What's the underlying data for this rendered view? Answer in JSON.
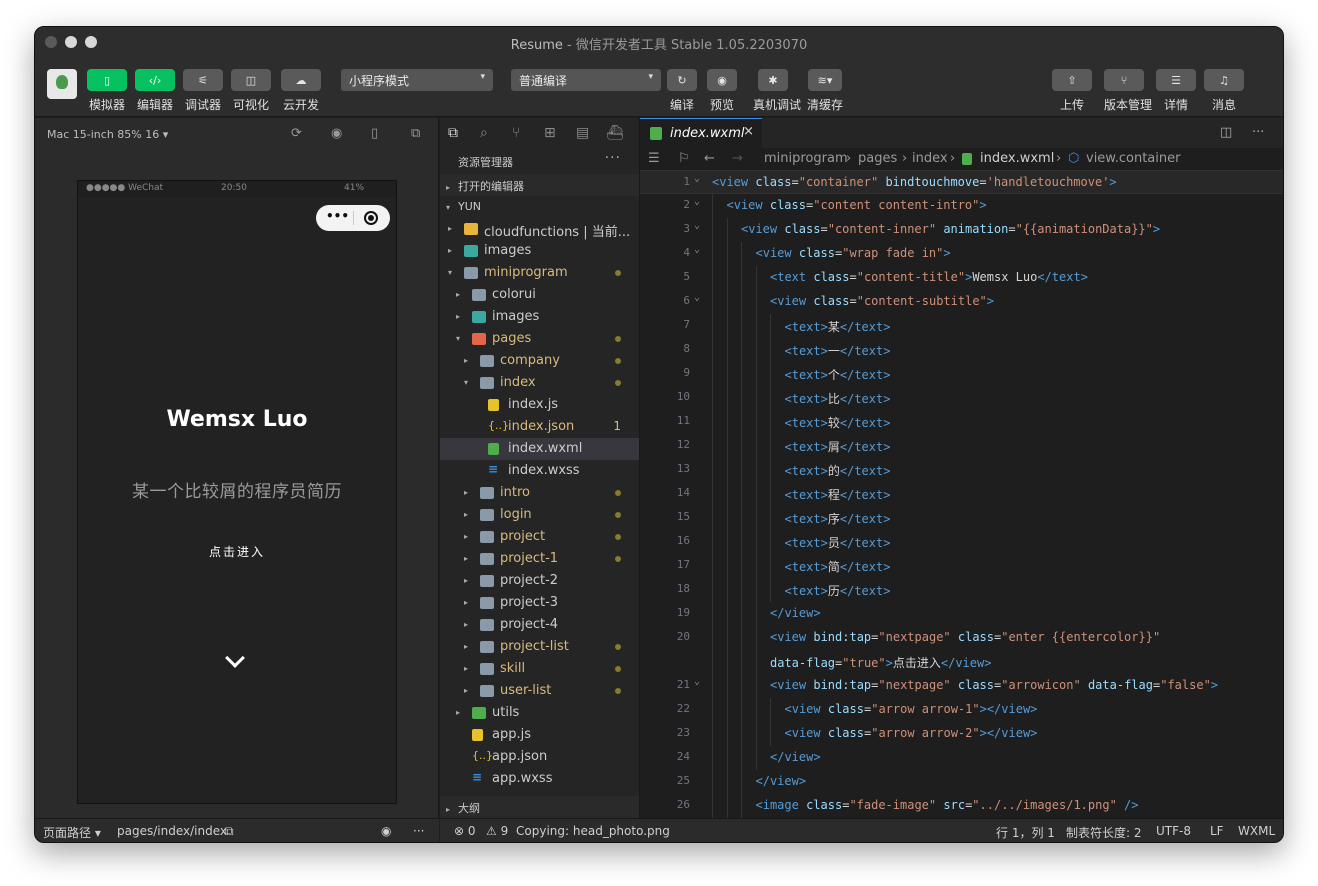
{
  "window": {
    "title_main": "Resume",
    "title_rest": " - 微信开发者工具 Stable 1.05.2203070"
  },
  "toolbar": {
    "buttons_left": [
      {
        "label": "模拟器",
        "icon": "phone-icon"
      },
      {
        "label": "编辑器",
        "icon": "code-icon"
      },
      {
        "label": "调试器",
        "icon": "debug-sliders-icon"
      },
      {
        "label": "可视化",
        "icon": "layout-icon"
      },
      {
        "label": "云开发",
        "icon": "cloud-icon"
      }
    ],
    "mode_select": "小程序模式",
    "compile_select": "普通编译",
    "buttons_mid": [
      {
        "label": "编译",
        "icon": "refresh-icon"
      },
      {
        "label": "预览",
        "icon": "eye-icon"
      },
      {
        "label": "真机调试",
        "icon": "bug-icon"
      },
      {
        "label": "清缓存",
        "icon": "layers-icon"
      }
    ],
    "buttons_right": [
      {
        "label": "上传",
        "icon": "upload-icon"
      },
      {
        "label": "版本管理",
        "icon": "branch-icon"
      },
      {
        "label": "详情",
        "icon": "menu-icon"
      },
      {
        "label": "消息",
        "icon": "bell-icon"
      }
    ]
  },
  "simulator": {
    "device": "Mac 15-inch 85% 16 ▾",
    "status_left": "●●●●● WeChat",
    "status_time": "20:50",
    "status_battery": "41%",
    "capsule_dots": "•••",
    "title": "Wemsx Luo",
    "subtitle": "某一个比较屑的程序员简历",
    "enter": "点击进入",
    "footer_path_label": "页面路径 ▾",
    "footer_path": "pages/index/index",
    "footer_more": "···"
  },
  "explorer": {
    "title": "资源管理器",
    "more": "···",
    "open_editors": "打开的编辑器",
    "project": "YUN",
    "outline": "大纲",
    "tree": [
      {
        "name": "cloudfunctions | 当前...",
        "depth": 0,
        "type": "folder-cloud",
        "caret": "▸",
        "mod": false
      },
      {
        "name": "images",
        "depth": 0,
        "type": "folder-img",
        "caret": "▸",
        "mod": false
      },
      {
        "name": "miniprogram",
        "depth": 0,
        "type": "folder-open",
        "caret": "▾",
        "mod": true,
        "dot": true
      },
      {
        "name": "colorui",
        "depth": 1,
        "type": "folder",
        "caret": "▸",
        "mod": false
      },
      {
        "name": "images",
        "depth": 1,
        "type": "folder-img",
        "caret": "▸",
        "mod": false
      },
      {
        "name": "pages",
        "depth": 1,
        "type": "folder-pg",
        "caret": "▾",
        "mod": true,
        "dot": true
      },
      {
        "name": "company",
        "depth": 2,
        "type": "folder",
        "caret": "▸",
        "mod": true,
        "dot": true
      },
      {
        "name": "index",
        "depth": 2,
        "type": "folder-open",
        "caret": "▾",
        "mod": true,
        "dot": true
      },
      {
        "name": "index.js",
        "depth": 3,
        "type": "js",
        "caret": "",
        "mod": false
      },
      {
        "name": "index.json",
        "depth": 3,
        "type": "json",
        "caret": "",
        "mod": true,
        "badge": "1"
      },
      {
        "name": "index.wxml",
        "depth": 3,
        "type": "wxml",
        "caret": "",
        "mod": false,
        "sel": true
      },
      {
        "name": "index.wxss",
        "depth": 3,
        "type": "wxss",
        "caret": "",
        "mod": false
      },
      {
        "name": "intro",
        "depth": 2,
        "type": "folder",
        "caret": "▸",
        "mod": true,
        "dot": true
      },
      {
        "name": "login",
        "depth": 2,
        "type": "folder",
        "caret": "▸",
        "mod": true,
        "dot": true
      },
      {
        "name": "project",
        "depth": 2,
        "type": "folder",
        "caret": "▸",
        "mod": true,
        "dot": true
      },
      {
        "name": "project-1",
        "depth": 2,
        "type": "folder",
        "caret": "▸",
        "mod": true,
        "dot": true
      },
      {
        "name": "project-2",
        "depth": 2,
        "type": "folder",
        "caret": "▸",
        "mod": false
      },
      {
        "name": "project-3",
        "depth": 2,
        "type": "folder",
        "caret": "▸",
        "mod": false
      },
      {
        "name": "project-4",
        "depth": 2,
        "type": "folder",
        "caret": "▸",
        "mod": false
      },
      {
        "name": "project-list",
        "depth": 2,
        "type": "folder",
        "caret": "▸",
        "mod": true,
        "dot": true
      },
      {
        "name": "skill",
        "depth": 2,
        "type": "folder",
        "caret": "▸",
        "mod": true,
        "dot": true
      },
      {
        "name": "user-list",
        "depth": 2,
        "type": "folder",
        "caret": "▸",
        "mod": true,
        "dot": true
      },
      {
        "name": "utils",
        "depth": 1,
        "type": "folder-ut",
        "caret": "▸",
        "mod": false
      },
      {
        "name": "app.js",
        "depth": 1,
        "type": "js",
        "caret": "",
        "mod": false
      },
      {
        "name": "app.json",
        "depth": 1,
        "type": "json",
        "caret": "",
        "mod": false
      },
      {
        "name": "app.wxss",
        "depth": 1,
        "type": "wxss",
        "caret": "",
        "mod": false
      }
    ]
  },
  "editor": {
    "tab": "index.wxml",
    "breadcrumb": [
      "miniprogram",
      "pages",
      "index",
      "index.wxml",
      "view.container"
    ],
    "lines": [
      {
        "n": "1",
        "fold": true,
        "indent": 0,
        "code": [
          [
            "tg",
            "<view "
          ],
          [
            "at",
            "class"
          ],
          [
            "",
            "="
          ],
          [
            "st",
            "\"container\""
          ],
          [
            "",
            " "
          ],
          [
            "at",
            "bindtouchmove"
          ],
          [
            "",
            "="
          ],
          [
            "st",
            "'handletouchmove'"
          ],
          [
            "tg",
            ">"
          ]
        ]
      },
      {
        "n": "2",
        "fold": true,
        "indent": 1,
        "code": [
          [
            "tg",
            "<view "
          ],
          [
            "at",
            "class"
          ],
          [
            "",
            "="
          ],
          [
            "st",
            "\"content content-intro\""
          ],
          [
            "tg",
            ">"
          ]
        ]
      },
      {
        "n": "3",
        "fold": true,
        "indent": 2,
        "code": [
          [
            "tg",
            "<view "
          ],
          [
            "at",
            "class"
          ],
          [
            "",
            "="
          ],
          [
            "st",
            "\"content-inner\""
          ],
          [
            "",
            " "
          ],
          [
            "at",
            "animation"
          ],
          [
            "",
            "="
          ],
          [
            "st",
            "\"{{animationData}}\""
          ],
          [
            "tg",
            ">"
          ]
        ]
      },
      {
        "n": "4",
        "fold": true,
        "indent": 3,
        "code": [
          [
            "tg",
            "<view "
          ],
          [
            "at",
            "class"
          ],
          [
            "",
            "="
          ],
          [
            "st",
            "\"wrap fade in\""
          ],
          [
            "tg",
            ">"
          ]
        ]
      },
      {
        "n": "5",
        "fold": false,
        "indent": 4,
        "code": [
          [
            "tg",
            "<text "
          ],
          [
            "at",
            "class"
          ],
          [
            "",
            "="
          ],
          [
            "st",
            "\"content-title\""
          ],
          [
            "tg",
            ">"
          ],
          [
            "",
            "Wemsx Luo"
          ],
          [
            "tg",
            "</text>"
          ]
        ]
      },
      {
        "n": "6",
        "fold": true,
        "indent": 4,
        "code": [
          [
            "tg",
            "<view "
          ],
          [
            "at",
            "class"
          ],
          [
            "",
            "="
          ],
          [
            "st",
            "\"content-subtitle\""
          ],
          [
            "tg",
            ">"
          ]
        ]
      },
      {
        "n": "7",
        "fold": false,
        "indent": 5,
        "code": [
          [
            "tg",
            "<text>"
          ],
          [
            "",
            "某"
          ],
          [
            "tg",
            "</text>"
          ]
        ]
      },
      {
        "n": "8",
        "fold": false,
        "indent": 5,
        "code": [
          [
            "tg",
            "<text>"
          ],
          [
            "",
            "一"
          ],
          [
            "tg",
            "</text>"
          ]
        ]
      },
      {
        "n": "9",
        "fold": false,
        "indent": 5,
        "code": [
          [
            "tg",
            "<text>"
          ],
          [
            "",
            "个"
          ],
          [
            "tg",
            "</text>"
          ]
        ]
      },
      {
        "n": "10",
        "fold": false,
        "indent": 5,
        "code": [
          [
            "tg",
            "<text>"
          ],
          [
            "",
            "比"
          ],
          [
            "tg",
            "</text>"
          ]
        ]
      },
      {
        "n": "11",
        "fold": false,
        "indent": 5,
        "code": [
          [
            "tg",
            "<text>"
          ],
          [
            "",
            "较"
          ],
          [
            "tg",
            "</text>"
          ]
        ]
      },
      {
        "n": "12",
        "fold": false,
        "indent": 5,
        "code": [
          [
            "tg",
            "<text>"
          ],
          [
            "",
            "屑"
          ],
          [
            "tg",
            "</text>"
          ]
        ]
      },
      {
        "n": "13",
        "fold": false,
        "indent": 5,
        "code": [
          [
            "tg",
            "<text>"
          ],
          [
            "",
            "的"
          ],
          [
            "tg",
            "</text>"
          ]
        ]
      },
      {
        "n": "14",
        "fold": false,
        "indent": 5,
        "code": [
          [
            "tg",
            "<text>"
          ],
          [
            "",
            "程"
          ],
          [
            "tg",
            "</text>"
          ]
        ]
      },
      {
        "n": "15",
        "fold": false,
        "indent": 5,
        "code": [
          [
            "tg",
            "<text>"
          ],
          [
            "",
            "序"
          ],
          [
            "tg",
            "</text>"
          ]
        ]
      },
      {
        "n": "16",
        "fold": false,
        "indent": 5,
        "code": [
          [
            "tg",
            "<text>"
          ],
          [
            "",
            "员"
          ],
          [
            "tg",
            "</text>"
          ]
        ]
      },
      {
        "n": "17",
        "fold": false,
        "indent": 5,
        "code": [
          [
            "tg",
            "<text>"
          ],
          [
            "",
            "简"
          ],
          [
            "tg",
            "</text>"
          ]
        ]
      },
      {
        "n": "18",
        "fold": false,
        "indent": 5,
        "code": [
          [
            "tg",
            "<text>"
          ],
          [
            "",
            "历"
          ],
          [
            "tg",
            "</text>"
          ]
        ]
      },
      {
        "n": "19",
        "fold": false,
        "indent": 4,
        "code": [
          [
            "tg",
            "</view>"
          ]
        ]
      },
      {
        "n": "20",
        "fold": false,
        "indent": 4,
        "code": [
          [
            "tg",
            "<view "
          ],
          [
            "at",
            "bind:tap"
          ],
          [
            "",
            "="
          ],
          [
            "st",
            "\"nextpage\""
          ],
          [
            "",
            " "
          ],
          [
            "at",
            "class"
          ],
          [
            "",
            "="
          ],
          [
            "st",
            "\"enter {{entercolor}}\""
          ]
        ]
      },
      {
        "n": "",
        "fold": false,
        "indent": 4,
        "code": [
          [
            "at",
            "data-flag"
          ],
          [
            "",
            "="
          ],
          [
            "st",
            "\"true\""
          ],
          [
            "tg",
            ">"
          ],
          [
            "",
            "点击进入"
          ],
          [
            "tg",
            "</view>"
          ]
        ]
      },
      {
        "n": "21",
        "fold": true,
        "indent": 4,
        "code": [
          [
            "tg",
            "<view "
          ],
          [
            "at",
            "bind:tap"
          ],
          [
            "",
            "="
          ],
          [
            "st",
            "\"nextpage\""
          ],
          [
            "",
            " "
          ],
          [
            "at",
            "class"
          ],
          [
            "",
            "="
          ],
          [
            "st",
            "\"arrowicon\""
          ],
          [
            "",
            " "
          ],
          [
            "at",
            "data-flag"
          ],
          [
            "",
            "="
          ],
          [
            "st",
            "\"false\""
          ],
          [
            "tg",
            ">"
          ]
        ]
      },
      {
        "n": "22",
        "fold": false,
        "indent": 5,
        "code": [
          [
            "tg",
            "<view "
          ],
          [
            "at",
            "class"
          ],
          [
            "",
            "="
          ],
          [
            "st",
            "\"arrow arrow-1\""
          ],
          [
            "tg",
            "></view>"
          ]
        ]
      },
      {
        "n": "23",
        "fold": false,
        "indent": 5,
        "code": [
          [
            "tg",
            "<view "
          ],
          [
            "at",
            "class"
          ],
          [
            "",
            "="
          ],
          [
            "st",
            "\"arrow arrow-2\""
          ],
          [
            "tg",
            "></view>"
          ]
        ]
      },
      {
        "n": "24",
        "fold": false,
        "indent": 4,
        "code": [
          [
            "tg",
            "</view>"
          ]
        ]
      },
      {
        "n": "25",
        "fold": false,
        "indent": 3,
        "code": [
          [
            "tg",
            "</view>"
          ]
        ]
      },
      {
        "n": "26",
        "fold": false,
        "indent": 3,
        "code": [
          [
            "tg",
            "<image "
          ],
          [
            "at",
            "class"
          ],
          [
            "",
            "="
          ],
          [
            "st",
            "\"fade-image\""
          ],
          [
            "",
            " "
          ],
          [
            "at",
            "src"
          ],
          [
            "",
            "="
          ],
          [
            "st",
            "\"../../images/1.png\""
          ],
          [
            "",
            " "
          ],
          [
            "tg",
            "/>"
          ]
        ]
      }
    ]
  },
  "status": {
    "errors": "⊗ 0",
    "warnings": "⚠ 9",
    "message": "Copying: head_photo.png",
    "position": "行 1，列 1",
    "tabsize": "制表符长度: 2",
    "encoding": "UTF-8",
    "eol": "LF",
    "language": "WXML"
  },
  "colors": {
    "accent": "#07c160",
    "tag": "#569cd6",
    "attr": "#9cdcfe",
    "string": "#ce9178",
    "modified": "#d7ba7d"
  }
}
